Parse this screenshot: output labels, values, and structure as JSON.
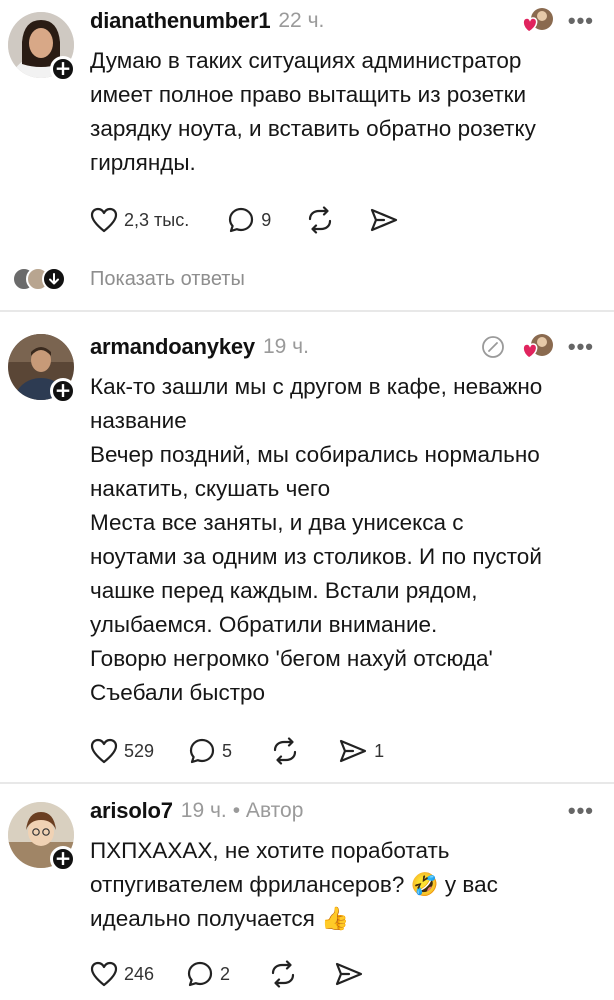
{
  "comments": [
    {
      "username": "dianathenumber1",
      "time": "22 ч.",
      "author_tag": "",
      "lines": [
        "Думаю в таких ситуациях администратор",
        "имеет полное право вытащить из розетки",
        "зарядку ноута, и вставить обратно розетку",
        "гирлянды."
      ],
      "likes": "2,3 тыс.",
      "replies": "9",
      "reposts": "",
      "shares": ""
    },
    {
      "username": "armandoanykey",
      "time": "19 ч.",
      "author_tag": "",
      "lines": [
        "Как-то зашли мы с другом в кафе, неважно",
        "название",
        "Вечер поздний, мы собирались нормально",
        "накатить, скушать чего",
        "Места все заняты, и два унисекса с",
        "ноутами за одним из столиков. И по пустой",
        "чашке перед каждым. Встали рядом,",
        "улыбаемся. Обратили внимание.",
        "Говорю негромко 'бегом нахуй отсюда'",
        "Съебали быстро"
      ],
      "likes": "529",
      "replies": "5",
      "reposts": "",
      "shares": "1"
    },
    {
      "username": "arisolo7",
      "time": "19 ч.",
      "author_tag": "• Автор",
      "lines": [
        "ПХПХАХАХ, не хотите поработать",
        "отпугивателем фрилансеров? 🤣 у вас",
        "идеально получается 👍"
      ],
      "likes": "246",
      "replies": "2",
      "reposts": "",
      "shares": ""
    }
  ],
  "show_replies_label": "Показать ответы",
  "more_glyph": "•••",
  "plus_glyph": "+",
  "colors": {
    "text": "#161616",
    "muted": "#9a9a9a",
    "divider": "#e8e8e8",
    "heart_red": "#e0245e"
  }
}
